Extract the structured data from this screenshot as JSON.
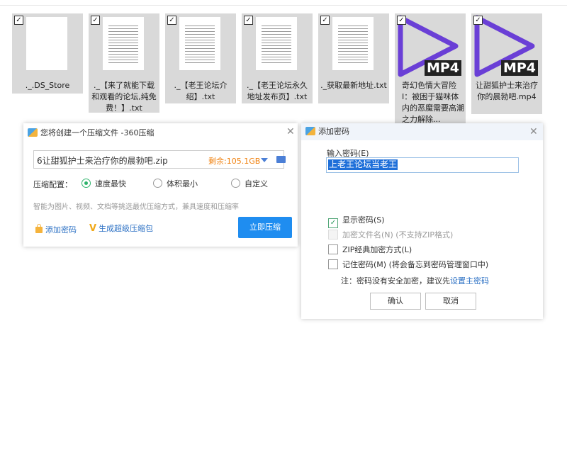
{
  "files": [
    {
      "name": "._.DS_Store",
      "kind": "doc",
      "checked": true
    },
    {
      "name": "._【来了就能下载和观看的论坛,纯免费！】.txt",
      "kind": "text",
      "checked": true
    },
    {
      "name": "._【老王论坛介绍】.txt",
      "kind": "text",
      "checked": true
    },
    {
      "name": "._【老王论坛永久地址发布页】.txt",
      "kind": "text",
      "checked": true
    },
    {
      "name": "._获取最新地址.txt",
      "kind": "text",
      "checked": true
    },
    {
      "name": "奇幻色情大冒险Ⅰ：被困于猫咪体内的恶魔需要高潮之力解除...",
      "kind": "mp4",
      "checked": true
    },
    {
      "name": "让甜狐护士来治疗你的晨勃吧.mp4",
      "kind": "mp4",
      "checked": true
    }
  ],
  "mp4_badge": "MP4",
  "compress_dialog": {
    "title": "您将创建一个压缩文件 -360压缩",
    "filename": "6让甜狐护士来治疗你的晨勃吧.zip",
    "remaining": "剩余:105.1GB",
    "config_label": "压缩配置：",
    "options": [
      "速度最快",
      "体积最小",
      "自定义"
    ],
    "selected_option": "速度最快",
    "hint": "智能为图片、视频、文档等挑选最优压缩方式，兼具速度和压缩率",
    "add_password": "添加密码",
    "super_package": "生成超级压缩包",
    "compress_now": "立即压缩",
    "close": "✕"
  },
  "password_dialog": {
    "title": "添加密码",
    "close": "✕",
    "input_label": "输入密码(E)",
    "password_value": "上老王论坛当老王",
    "show_password": "显示密码(S)",
    "encrypt_filenames": "加密文件名(N) (不支持ZIP格式)",
    "zip_classic": "ZIP经典加密方式(L)",
    "remember_password": "记住密码(M) (将会备忘到密码管理窗口中)",
    "note_prefix": "注：密码没有安全加密，建议先",
    "note_link": "设置主密码",
    "ok": "确认",
    "cancel": "取消"
  },
  "colors": {
    "accent_blue": "#1f8df0",
    "play_purple": "#6a3fd6",
    "remaining_orange": "#f0810f"
  }
}
